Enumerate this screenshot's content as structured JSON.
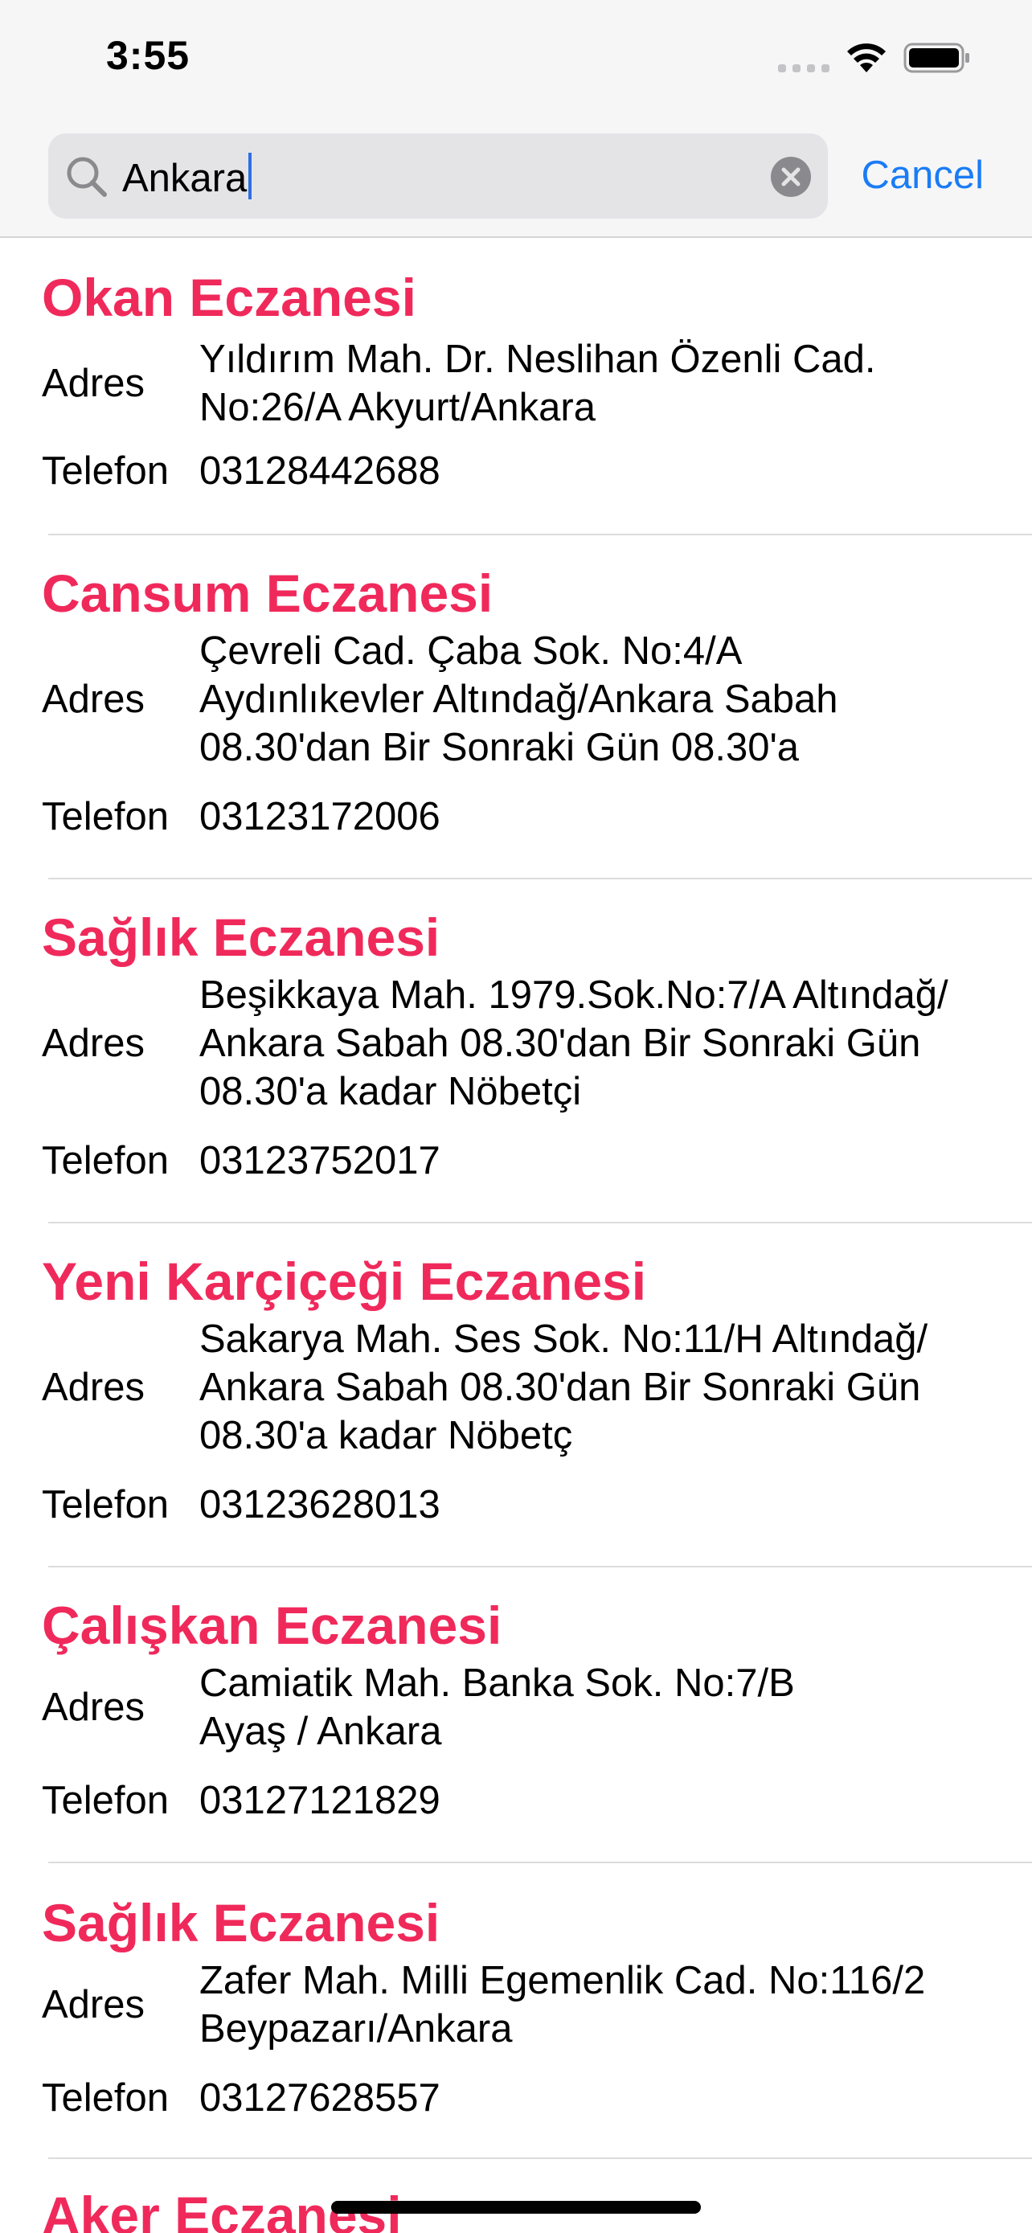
{
  "status_bar": {
    "time": "3:55"
  },
  "search": {
    "query": "Ankara",
    "cancel_label": "Cancel"
  },
  "labels": {
    "address": "Adres",
    "phone": "Telefon"
  },
  "pharmacies": [
    {
      "name": "Okan Eczanesi",
      "address": "Yıldırım Mah. Dr. Neslihan Özenli Cad.\nNo:26/A Akyurt/Ankara",
      "phone": "03128442688"
    },
    {
      "name": "Cansum Eczanesi",
      "address": "Çevreli Cad. Çaba Sok. No:4/A\nAydınlıkevler Altındağ/Ankara  Sabah\n08.30'dan Bir Sonraki Gün 08.30'a",
      "phone": "03123172006"
    },
    {
      "name": "Sağlık Eczanesi",
      "address": "Beşikkaya Mah. 1979.Sok.No:7/A Altındağ/\nAnkara Sabah 08.30'dan Bir Sonraki Gün\n08.30'a kadar Nöbetçi",
      "phone": "03123752017"
    },
    {
      "name": "Yeni Karçiçeği Eczanesi",
      "address": "Sakarya Mah. Ses Sok. No:11/H  Altındağ/\nAnkara  Sabah 08.30'dan Bir Sonraki Gün\n08.30'a kadar Nöbetç",
      "phone": "03123628013"
    },
    {
      "name": "Çalışkan Eczanesi",
      "address": "Camiatik Mah. Banka Sok. No:7/B\nAyaş / Ankara",
      "phone": "03127121829"
    },
    {
      "name": "Sağlık Eczanesi",
      "address": "Zafer Mah. Milli Egemenlik Cad. No:116/2\nBeypazarı/Ankara",
      "phone": "03127628557"
    },
    {
      "name": "Aker Eczanesi"
    }
  ],
  "colors": {
    "accent_name": "#f0295b",
    "link_blue": "#1a7cf5",
    "header_bg": "#f6f6f7",
    "search_field_bg": "#e4e4e7"
  },
  "icons": {
    "search": "magnifying-glass-icon",
    "clear": "clear-circle-x-icon",
    "wifi": "wifi-icon",
    "battery": "battery-icon",
    "signal": "cellular-signal-icon"
  }
}
